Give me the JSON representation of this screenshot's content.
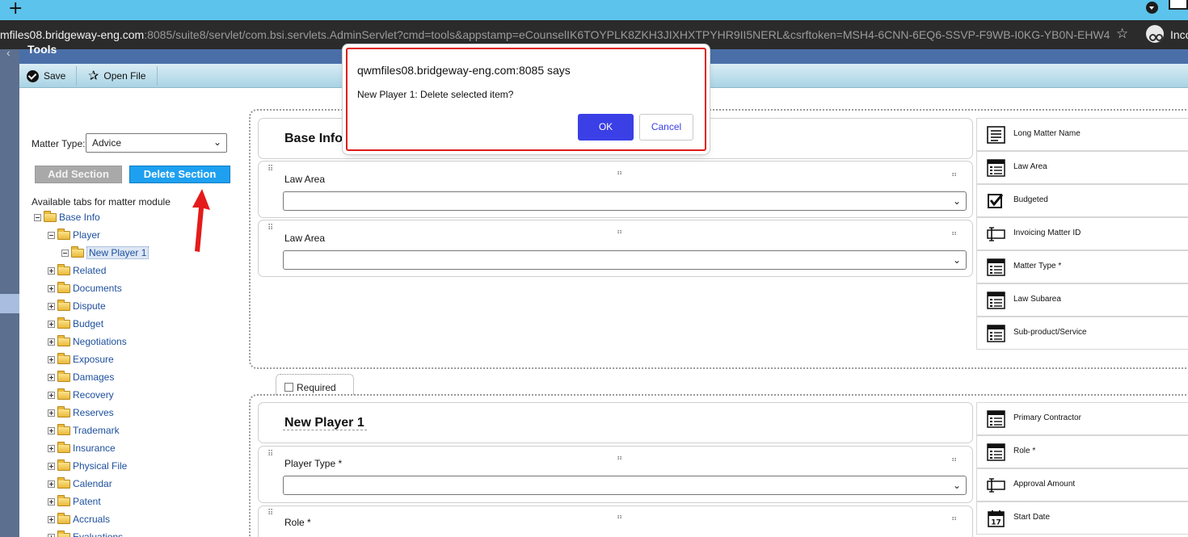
{
  "browser": {
    "new_tab_glyph": "+",
    "url_host": "mfiles08.bridgeway-eng.com",
    "url_rest": ":8085/suite8/servlet/com.bsi.servlets.AdminServlet?cmd=tools&appstamp=eCounselIK6TOYPLK8ZKH3JIXHXTPYHR9II5NERL&csrftoken=MSH4-6CNN-6EQ6-SSVP-F9WB-I0KG-YB0N-EHW4",
    "bookmark_icon": "star-outline",
    "incognito_label": "Inco"
  },
  "app": {
    "title": "Tools"
  },
  "toolbar": {
    "save_label": "Save",
    "open_file_label": "Open File"
  },
  "left_panel": {
    "matter_type_label": "Matter Type:",
    "matter_type_value": "Advice",
    "add_section_label": "Add Section",
    "delete_section_label": "Delete Section",
    "available_tabs_label": "Available tabs for matter module",
    "tree": {
      "root": "Base Info",
      "player": "Player",
      "new_player": "New Player 1",
      "items": [
        "Related",
        "Documents",
        "Dispute",
        "Budget",
        "Negotiations",
        "Exposure",
        "Damages",
        "Recovery",
        "Reserves",
        "Trademark",
        "Insurance",
        "Physical File",
        "Calendar",
        "Patent",
        "Accruals",
        "Evaluations"
      ]
    }
  },
  "designer": {
    "section1": {
      "title": "Base Info",
      "fields": [
        {
          "label": "Law Area",
          "value": ""
        },
        {
          "label": "Law Area",
          "value": ""
        }
      ]
    },
    "required_label": "Required",
    "section2": {
      "title": "New Player 1",
      "fields": [
        {
          "label": "Player Type *",
          "value": ""
        },
        {
          "label": "Role *",
          "value": ""
        }
      ]
    }
  },
  "palette": {
    "section1": [
      {
        "label": "Long Matter Name",
        "icon": "text-lines-icon"
      },
      {
        "label": "Law Area",
        "icon": "list-box-icon"
      },
      {
        "label": "Budgeted",
        "icon": "checkbox-icon"
      },
      {
        "label": "Invoicing Matter ID",
        "icon": "text-input-icon"
      },
      {
        "label": "Matter Type *",
        "icon": "list-box-icon"
      },
      {
        "label": "Law Subarea",
        "icon": "list-box-icon"
      },
      {
        "label": "Sub-product/Service",
        "icon": "list-box-icon"
      }
    ],
    "section2": [
      {
        "label": "Primary Contractor",
        "icon": "list-box-icon"
      },
      {
        "label": "Role *",
        "icon": "list-box-icon"
      },
      {
        "label": "Approval Amount",
        "icon": "text-input-icon"
      },
      {
        "label": "Start Date",
        "icon": "calendar-icon"
      }
    ],
    "calendar_day": "17"
  },
  "dialog": {
    "origin": "qwmfiles08.bridgeway-eng.com:8085 says",
    "message": "New Player 1: Delete selected item?",
    "ok_label": "OK",
    "cancel_label": "Cancel",
    "accent_color": "#3a3fe6",
    "border_color": "#e01919"
  }
}
